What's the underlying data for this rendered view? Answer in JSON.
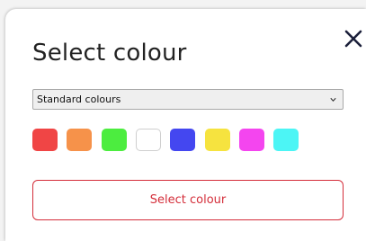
{
  "dialog": {
    "title": "Select colour",
    "close_icon": "close-icon"
  },
  "palette_select": {
    "selected": "Standard colours",
    "icon": "chevron-down-icon"
  },
  "swatches": [
    {
      "name": "red",
      "color": "#f04545",
      "selected": false
    },
    {
      "name": "orange",
      "color": "#f6924a",
      "selected": false
    },
    {
      "name": "green",
      "color": "#4ced3f",
      "selected": false
    },
    {
      "name": "white",
      "color": "#ffffff",
      "selected": false
    },
    {
      "name": "blue",
      "color": "#4447f0",
      "selected": false
    },
    {
      "name": "yellow",
      "color": "#f6e33f",
      "selected": false
    },
    {
      "name": "magenta",
      "color": "#f445ef",
      "selected": false
    },
    {
      "name": "cyan",
      "color": "#4cf5f5",
      "selected": false
    }
  ],
  "confirm_button": {
    "label": "Select colour",
    "color": "#d42e3a"
  }
}
